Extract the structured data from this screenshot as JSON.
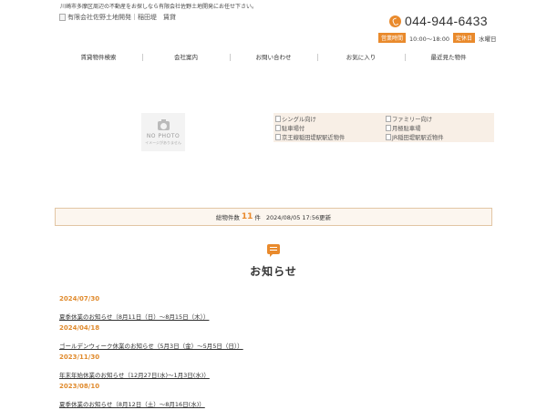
{
  "header": {
    "tagline": "川崎市多摩区周辺の不動産をお探しなら有限会社佐野土地開発にお任せ下さい。",
    "logo_alt": "有限会社佐野土地開発｜稲田堤　賃貸",
    "phone": "044-944-6433",
    "hours_label": "営業時間",
    "hours_value": "10:00～18:00",
    "holiday_label": "定休日",
    "holiday_value": "水曜日",
    "accent_color": "#e98a2c"
  },
  "nav": {
    "items": [
      {
        "label": "賃貸物件検索"
      },
      {
        "label": "会社案内"
      },
      {
        "label": "お問い合わせ"
      },
      {
        "label": "お気に入り"
      },
      {
        "label": "最近見た物件"
      }
    ]
  },
  "no_photo": {
    "title": "NO PHOTO",
    "subtitle": "イメージがありません"
  },
  "categories": [
    {
      "label": "シングル向け"
    },
    {
      "label": "ファミリー向け"
    },
    {
      "label": "駐車場付"
    },
    {
      "label": "月極駐車場"
    },
    {
      "label": "京王線稲田堤駅駅近物件"
    },
    {
      "label": "JR稲田堤駅駅近物件"
    }
  ],
  "count_bar": {
    "prefix": "総物件数",
    "count": "11",
    "suffix": "件",
    "updated": "2024/08/05 17:56更新"
  },
  "news": {
    "heading": "お知らせ",
    "items": [
      {
        "date": "2024/07/30",
        "title": "夏季休業のお知らせ（8月11日（日）～8月15日（木））"
      },
      {
        "date": "2024/04/18",
        "title": "ゴールデンウィーク休業のお知らせ（5月3日（金）～5月5日（日））"
      },
      {
        "date": "2023/11/30",
        "title": "年末年始休業のお知らせ（12月27日(水)～1月3日(水)）"
      },
      {
        "date": "2023/08/10",
        "title": "夏季休業のお知らせ（8月12日（土）～8月16日(水)）"
      }
    ]
  }
}
